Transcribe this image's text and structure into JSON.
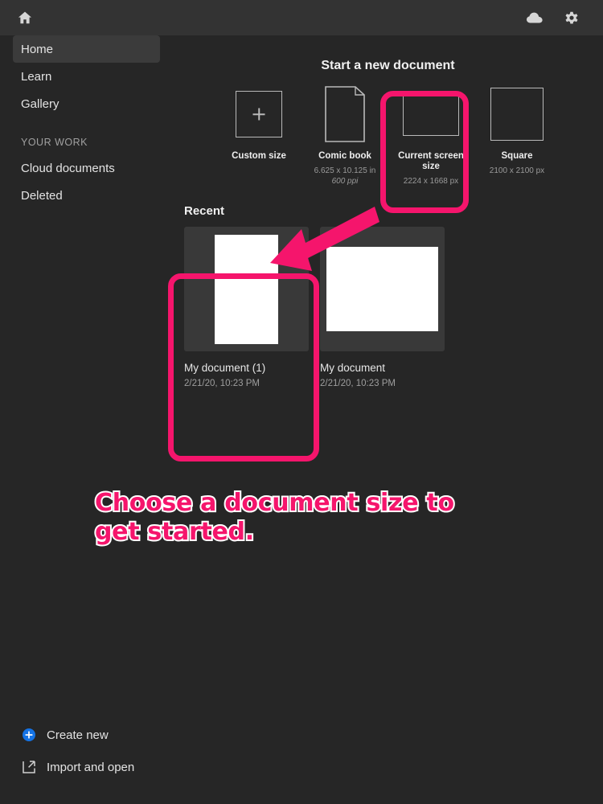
{
  "theme": {
    "bg": "#262626",
    "topbar_bg": "#333333",
    "card_bg": "#393939",
    "accent_pink": "#f5156c",
    "accent_blue": "#1473e6",
    "text": "#e8e8e8",
    "muted_text": "#9a9a9a"
  },
  "topbar": {
    "home_icon": "home-icon",
    "cloud_icon": "cloud-icon",
    "settings_icon": "gear-icon"
  },
  "sidebar": {
    "items": [
      {
        "label": "Home",
        "selected": true
      },
      {
        "label": "Learn",
        "selected": false
      },
      {
        "label": "Gallery",
        "selected": false
      }
    ],
    "section_label": "YOUR WORK",
    "work_items": [
      {
        "label": "Cloud documents"
      },
      {
        "label": "Deleted"
      }
    ],
    "bottom_actions": [
      {
        "label": "Create new",
        "icon": "plus-circle-icon"
      },
      {
        "label": "Import and open",
        "icon": "import-icon"
      }
    ]
  },
  "main": {
    "new_document_heading": "Start a new document",
    "presets": [
      {
        "name": "Custom size",
        "spec": "",
        "ppi": "",
        "icon": "custom-size-icon",
        "highlighted": false
      },
      {
        "name": "Comic book",
        "spec": "6.625 x 10.125 in",
        "ppi": "600 ppi",
        "icon": "comic-book-icon",
        "highlighted": false
      },
      {
        "name": "Current screen size",
        "spec": "2224 x 1668 px",
        "ppi": "",
        "icon": "screen-size-icon",
        "highlighted": true
      },
      {
        "name": "Square",
        "spec": "2100 x 2100 px",
        "ppi": "",
        "icon": "square-icon",
        "highlighted": false
      }
    ],
    "recent_heading": "Recent",
    "recent_documents": [
      {
        "name": "My document (1)",
        "date": "2/21/20, 10:23 PM",
        "orientation": "portrait",
        "highlighted": true
      },
      {
        "name": "My document",
        "date": "2/21/20, 10:23 PM",
        "orientation": "landscape",
        "highlighted": false
      }
    ]
  },
  "annotations": {
    "callout_text": "Choose a document size to get started.",
    "arrow": "pink-arrow-pointing-to-recent-document",
    "highlight_boxes": [
      "current-screen-size-preset",
      "first-recent-document"
    ]
  }
}
